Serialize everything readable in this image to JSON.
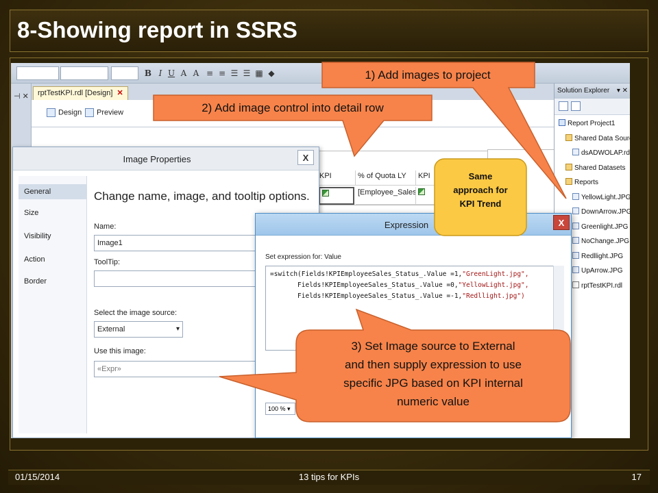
{
  "slide": {
    "title": "8-Showing report in SSRS",
    "footer": {
      "date": "01/15/2014",
      "center": "13 tips for KPIs",
      "page": "17"
    }
  },
  "vs": {
    "doc_tab": "rptTestKPI.rdl [Design]",
    "design_tab": "Design",
    "preview_tab": "Preview"
  },
  "report_table": {
    "headers": [
      "KPI",
      "% of Quota LY",
      "KPI"
    ],
    "row": [
      "",
      "[Employee_Sales_",
      ""
    ]
  },
  "solution_explorer": {
    "title": "Solution Explorer",
    "items": [
      {
        "label": "Report Project1",
        "icon": "project-icon",
        "level": 0
      },
      {
        "label": "Shared Data Sources",
        "icon": "folder-icon",
        "level": 1
      },
      {
        "label": "dsADWOLAP.rds",
        "icon": "file-icon",
        "level": 2
      },
      {
        "label": "Shared Datasets",
        "icon": "folder-icon",
        "level": 1
      },
      {
        "label": "Reports",
        "icon": "folder-icon",
        "level": 1
      },
      {
        "label": "YellowLight.JPG",
        "icon": "file-icon",
        "level": 2
      },
      {
        "label": "DownArrow.JPG",
        "icon": "file-icon",
        "level": 2
      },
      {
        "label": "Greenlight.JPG",
        "icon": "file-icon",
        "level": 2
      },
      {
        "label": "NoChange.JPG",
        "icon": "file-icon",
        "level": 2
      },
      {
        "label": "Redllight.JPG",
        "icon": "file-icon",
        "level": 2
      },
      {
        "label": "UpArrow.JPG",
        "icon": "file-icon",
        "level": 2
      },
      {
        "label": "rptTestKPI.rdl",
        "icon": "rdl-icon",
        "level": 2
      }
    ]
  },
  "image_properties": {
    "title": "Image Properties",
    "close": "X",
    "nav": [
      "General",
      "Size",
      "Visibility",
      "Action",
      "Border"
    ],
    "heading": "Change name, image, and tooltip options.",
    "name_label": "Name:",
    "name_value": "Image1",
    "tooltip_label": "ToolTip:",
    "tooltip_value": "",
    "source_label": "Select the image source:",
    "source_value": "External",
    "use_label": "Use this image:",
    "use_value": "«Expr»"
  },
  "expression_dialog": {
    "title": "Expression",
    "close": "X",
    "label": "Set expression for: Value",
    "code": [
      "=switch(Fields!KPIEmployeeSales_Status_.Value =1,",
      "\"GreenLight.jpg\",",
      "       Fields!KPIEmployeeSales_Status_.Value =0,",
      "\"YellowLight.jpg\",",
      "       Fields!KPIEmployeeSales_Status_.Value =-1,",
      "\"Redllight.jpg\")"
    ],
    "zoom": "100 %"
  },
  "callouts": {
    "c1": "1) Add images to project",
    "c2": "2) Add image control into detail row",
    "c3_lines": [
      "3)  Set Image source to External",
      "and then supply expression to use",
      "specific JPG based on KPI internal",
      "numeric value"
    ],
    "c4_lines": [
      "Same",
      "approach for",
      "KPI Trend"
    ]
  },
  "colors": {
    "callout_orange": "#f7834a",
    "callout_yellow": "#fcc944",
    "slide_bg": "#3d2f0d"
  }
}
